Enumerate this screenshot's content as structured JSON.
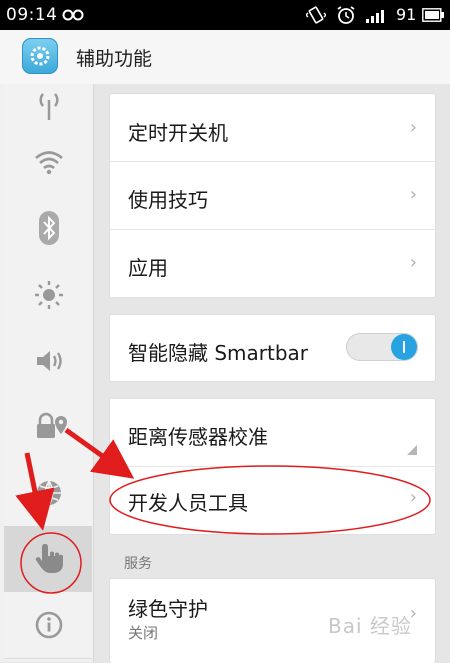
{
  "status_bar": {
    "time": "09:14",
    "battery_percent": "91"
  },
  "app_bar": {
    "title": "辅助功能",
    "app_icon": "settings-app-icon"
  },
  "sidebar": {
    "items": [
      {
        "icon": "antenna-icon"
      },
      {
        "icon": "wifi-icon"
      },
      {
        "icon": "bluetooth-icon"
      },
      {
        "icon": "brightness-icon"
      },
      {
        "icon": "volume-icon"
      },
      {
        "icon": "lock-location-icon"
      },
      {
        "icon": "globe-icon"
      },
      {
        "icon": "hand-pointer-icon",
        "active": true
      },
      {
        "icon": "info-icon"
      }
    ]
  },
  "groups": {
    "group1": [
      {
        "label": "定时开关机"
      },
      {
        "label": "使用技巧"
      },
      {
        "label": "应用"
      }
    ],
    "smartbar": {
      "label": "智能隐藏 Smartbar",
      "toggle_on": true
    },
    "group3": [
      {
        "label": "距离传感器校准"
      },
      {
        "label": "开发人员工具"
      }
    ]
  },
  "services_header": "服务",
  "green_guard": {
    "label": "绿色守护",
    "status": "关闭"
  },
  "chevron": "›",
  "watermark": "Bai 经验",
  "annotation_color": "#e01c1c"
}
